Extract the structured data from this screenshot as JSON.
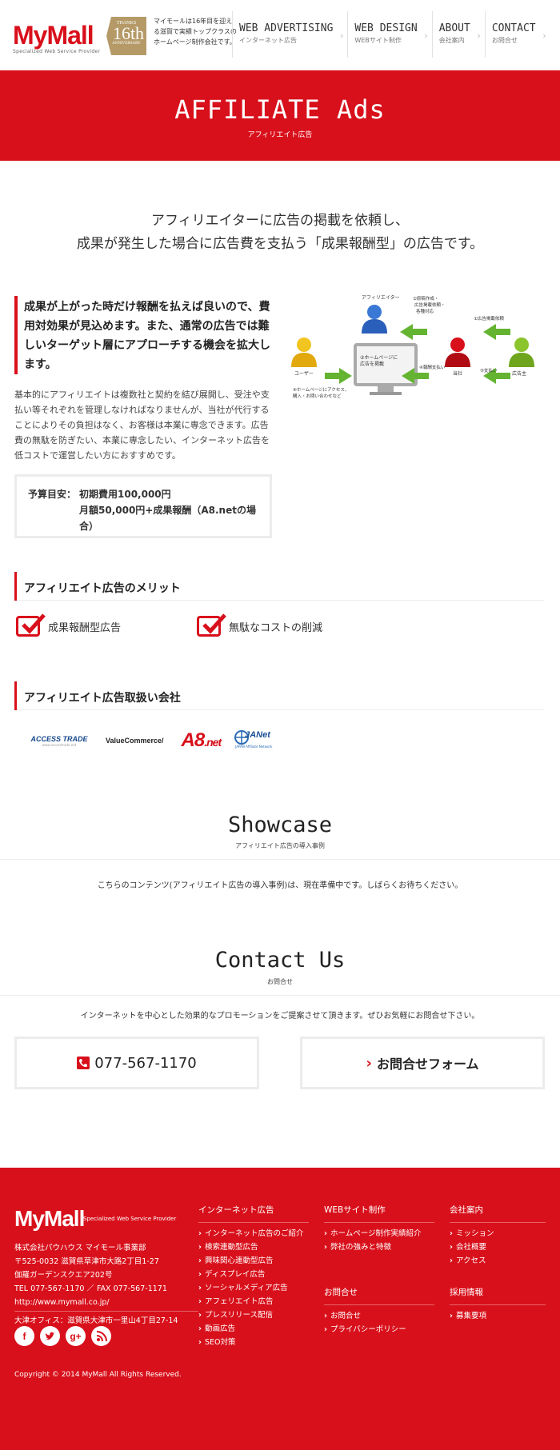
{
  "header": {
    "logo": "MyMall",
    "logo_sub": "Specialized Web Service Provider",
    "badge": {
      "thanks": "THANKS",
      "number": "16th",
      "anniversary": "ANNIVERSARY"
    },
    "intro": "マイモールは16年目を迎える滋賀で実績トップクラスのホームページ制作会社です。",
    "nav": [
      {
        "en": "WEB ADVERTISING",
        "jp": "インターネット広告"
      },
      {
        "en": "WEB DESIGN",
        "jp": "WEBサイト制作"
      },
      {
        "en": "ABOUT",
        "jp": "会社案内"
      },
      {
        "en": "CONTACT",
        "jp": "お問合せ"
      }
    ]
  },
  "hero": {
    "title": "AFFILIATE Ads",
    "subtitle": "アフィリエイト広告"
  },
  "lead": {
    "line1": "アフィリエイターに広告の掲載を依頼し、",
    "line2": "成果が発生した場合に広告費を支払う「成果報酬型」の広告です。"
  },
  "feature": {
    "highlight": "成果が上がった時だけ報酬を払えば良いので、費用対効果が見込めます。また、通常の広告では難しいターゲット層にアプローチする機会を拡大します。",
    "body": "基本的にアフィリエイトは複数社と契約を結び展開し、受注や支払い等それぞれを管理しなければなりませんが、当社が代行することによりその負担はなく、お客様は本業に専念できます。広告費の無駄を防ぎたい、本業に専念したい、インターネット広告を低コストで運営したい方におすすめです。",
    "budget_label": "予算目安：",
    "budget_line1": "初期費用100,000円",
    "budget_line2": "月額50,000円+成果報酬（A8.netの場合）"
  },
  "diagram": {
    "affiliator": "アフィリエイター",
    "user": "ユーザー",
    "company": "当社",
    "advertiser": "広告主",
    "step1": "①広告掲載依頼",
    "step2a": "②原稿作成・",
    "step2b": "広告掲載依頼・",
    "step2c": "各種対応",
    "step3a": "③ホームページに",
    "step3b": "広告を掲載",
    "step4": "④報酬支払い",
    "step5": "⑤支払い",
    "step6a": "④ホームページにアクセス、",
    "step6b": "購入・お問い合わせなど"
  },
  "merits": {
    "title": "アフィリエイト広告のメリット",
    "items": [
      "成果報酬型広告",
      "無駄なコストの削減"
    ]
  },
  "partners": {
    "title": "アフィリエイト広告取扱い会社",
    "access_trade": "ACCESS TRADE",
    "access_url": "www.accesstrade.net",
    "value_commerce": "ValueCommerce/",
    "a8": "A8",
    "a8_net": ".net",
    "jan": "JANet",
    "jan_sub": "JAPAN Affiliate Network"
  },
  "showcase": {
    "title": "Showcase",
    "subtitle": "アフィリエイト広告の導入事例",
    "notice": "こちらのコンテンツ(アフィリエイト広告の導入事例)は、現在準備中です。しばらくお待ちください。"
  },
  "contact": {
    "title": "Contact Us",
    "subtitle": "お問合せ",
    "text": "インターネットを中心とした効果的なプロモーションをご提案させて頂きます。ぜひお気軽にお問合せ下さい。",
    "phone": "077-567-1170",
    "form_label": "お問合せフォーム"
  },
  "footer": {
    "logo": "MyMall",
    "logo_sub": "Specialized Web Service Provider",
    "company": "株式会社パウハウス マイモール事業部",
    "postal": "〒525-0032 滋賀県草津市大路2丁目1-27",
    "building": "伽羅ガーデンスクエア202号",
    "tel": "TEL 077-567-1170 ／ FAX 077-567-1171",
    "url": "http://www.mymall.co.jp/",
    "office": "大津オフィス：滋賀県大津市一里山4丁目27-14",
    "copyright": "Copyright © 2014 MyMall All Rights Reserved.",
    "col1": {
      "title": "インターネット広告",
      "items": [
        "インターネット広告のご紹介",
        "検索連動型広告",
        "興味関心連動型広告",
        "ディスプレイ広告",
        "ソーシャルメディア広告",
        "アフェリエイト広告",
        "プレスリリース配信",
        "動画広告",
        "SEO対策"
      ]
    },
    "col2": {
      "title": "WEBサイト制作",
      "items": [
        "ホームページ制作実績紹介",
        "弊社の強みと特徴"
      ]
    },
    "col3": {
      "title": "お問合せ",
      "items": [
        "お問合せ",
        "プライバシーポリシー"
      ]
    },
    "col4": {
      "title": "会社案内",
      "items": [
        "ミッション",
        "会社概要",
        "アクセス"
      ]
    },
    "col5": {
      "title": "採用情報",
      "items": [
        "募集要項"
      ]
    }
  }
}
